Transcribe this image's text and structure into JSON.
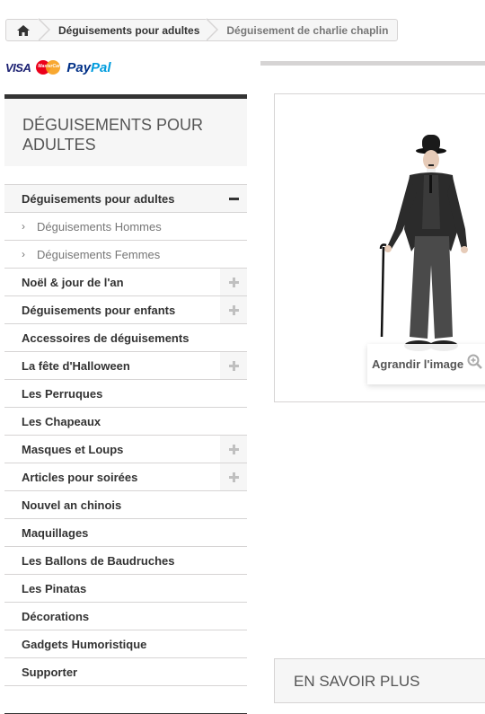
{
  "breadcrumb": {
    "home_icon": "home-icon",
    "items": [
      "Déguisements pour adultes",
      "Déguisement de charlie chaplin"
    ]
  },
  "payments": {
    "visa": "VISA",
    "mastercard": "MasterCard",
    "paypal_1": "Pay",
    "paypal_2": "Pal"
  },
  "sidebar": {
    "title": "DÉGUISEMENTS POUR ADULTES",
    "items": [
      {
        "label": "Déguisements pour adultes",
        "toggle": "minus"
      },
      {
        "label": "Déguisements Hommes",
        "sub": true
      },
      {
        "label": "Déguisements Femmes",
        "sub": true
      },
      {
        "label": "Noël & jour de l'an",
        "toggle": "plus"
      },
      {
        "label": "Déguisements pour enfants",
        "toggle": "plus"
      },
      {
        "label": "Accessoires de déguisements"
      },
      {
        "label": "La fête d'Halloween",
        "toggle": "plus"
      },
      {
        "label": "Les Perruques"
      },
      {
        "label": "Les Chapeaux"
      },
      {
        "label": "Masques et Loups",
        "toggle": "plus"
      },
      {
        "label": "Articles pour soirées",
        "toggle": "plus"
      },
      {
        "label": "Nouvel an chinois"
      },
      {
        "label": "Maquillages"
      },
      {
        "label": "Les Ballons de Baudruches"
      },
      {
        "label": "Les Pinatas"
      },
      {
        "label": "Décorations"
      },
      {
        "label": "Gadgets Humoristique"
      },
      {
        "label": "Supporter"
      }
    ]
  },
  "product": {
    "zoom_label": "Agrandir l'image",
    "zoom_icon": "zoom-in-icon"
  },
  "more_section": {
    "title": "EN SAVOIR PLUS"
  },
  "colors": {
    "border": "#d6d4d4",
    "panel": "#f6f6f6",
    "text": "#333333"
  }
}
